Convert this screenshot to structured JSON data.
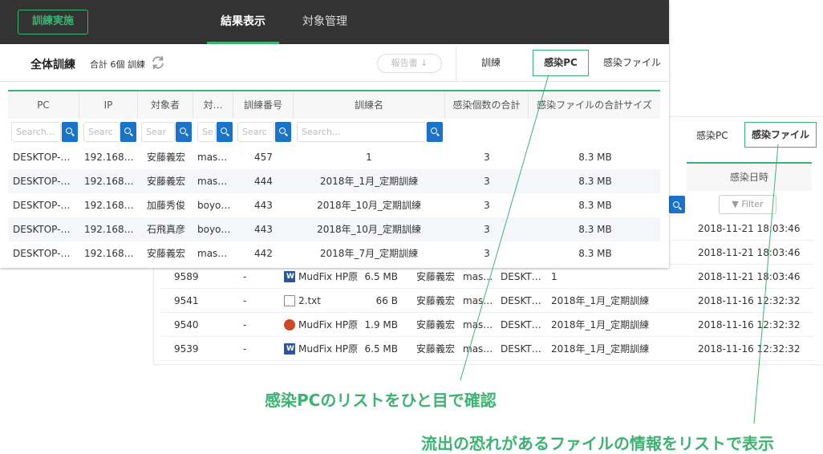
{
  "colors": {
    "accent": "#3cb371",
    "topbar": "#333333",
    "search_button": "#1a73c9"
  },
  "topbar": {
    "train_button": "訓練実施",
    "tabs": [
      "結果表示",
      "対象管理"
    ]
  },
  "subheader": {
    "title": "全体訓練",
    "count": "合計 6個 訓練",
    "report_button": "報告書 ↓",
    "tabs": [
      "訓練",
      "感染PC",
      "感染ファイル"
    ]
  },
  "pc_table": {
    "headers": [
      "PC",
      "IP",
      "対象者",
      "対…",
      "訓練番号",
      "訓練名",
      "感染個数の合計",
      "感染ファイルの合計サイズ"
    ],
    "placeholders": [
      "Search…",
      "Searc",
      "Sear",
      "Se",
      "Searc",
      "Search…"
    ],
    "rows": [
      {
        "pc": "DESKTOP-…",
        "ip": "192.168…",
        "user": "安藤義宏",
        "acc": "mas…",
        "no": "457",
        "name": "1",
        "count": "3",
        "size": "8.3 MB"
      },
      {
        "pc": "DESKTOP-…",
        "ip": "192.168…",
        "user": "安藤義宏",
        "acc": "mas…",
        "no": "444",
        "name": "2018年_1月_定期訓練",
        "count": "3",
        "size": "8.3 MB"
      },
      {
        "pc": "DESKTOP-…",
        "ip": "192.168…",
        "user": "加藤秀俊",
        "acc": "boyo…",
        "no": "443",
        "name": "2018年_10月_定期訓練",
        "count": "3",
        "size": "8.3 MB"
      },
      {
        "pc": "DESKTOP-…",
        "ip": "192.168…",
        "user": "石飛真彦",
        "acc": "boyo…",
        "no": "443",
        "name": "2018年_10月_定期訓練",
        "count": "3",
        "size": "8.3 MB"
      },
      {
        "pc": "DESKTOP-…",
        "ip": "192.168…",
        "user": "安藤義宏",
        "acc": "mas…",
        "no": "442",
        "name": "2018年_7月_定期訓練",
        "count": "3",
        "size": "8.3 MB"
      }
    ]
  },
  "file_panel": {
    "tabs": [
      "感染PC",
      "感染ファイル"
    ],
    "date_header": "感染日時",
    "filter_label": "Filter",
    "dates_above": [
      "2018-11-21 18:03:46",
      "2018-11-21 18:03:46"
    ],
    "rows": [
      {
        "id": "9589",
        "dash": "-",
        "icon": "word-file-icon",
        "name": "MudFix HP原",
        "size": "6.5 MB",
        "user": "安藤義宏",
        "acc": "mas…",
        "pc": "DESKT…",
        "train": "1",
        "date": "2018-11-21 18:03:46"
      },
      {
        "id": "9541",
        "dash": "-",
        "icon": "text-file-icon",
        "name": "2.txt",
        "size": "66 B",
        "user": "安藤義宏",
        "acc": "mas…",
        "pc": "DESKT…",
        "train": "2018年_1月_定期訓練",
        "date": "2018-11-16 12:32:32"
      },
      {
        "id": "9540",
        "dash": "-",
        "icon": "powerpoint-file-icon",
        "name": "MudFix HP原",
        "size": "1.9 MB",
        "user": "安藤義宏",
        "acc": "mas…",
        "pc": "DESKT…",
        "train": "2018年_1月_定期訓練",
        "date": "2018-11-16 12:32:32"
      },
      {
        "id": "9539",
        "dash": "-",
        "icon": "word-file-icon",
        "name": "MudFix HP原",
        "size": "6.5 MB",
        "user": "安藤義宏",
        "acc": "mas…",
        "pc": "DESKT…",
        "train": "2018年_1月_定期訓練",
        "date": "2018-11-16 12:32:32"
      }
    ]
  },
  "callouts": [
    "感染PCのリストをひと目で確認",
    "流出の恐れがあるファイルの情報をリストで表示"
  ]
}
